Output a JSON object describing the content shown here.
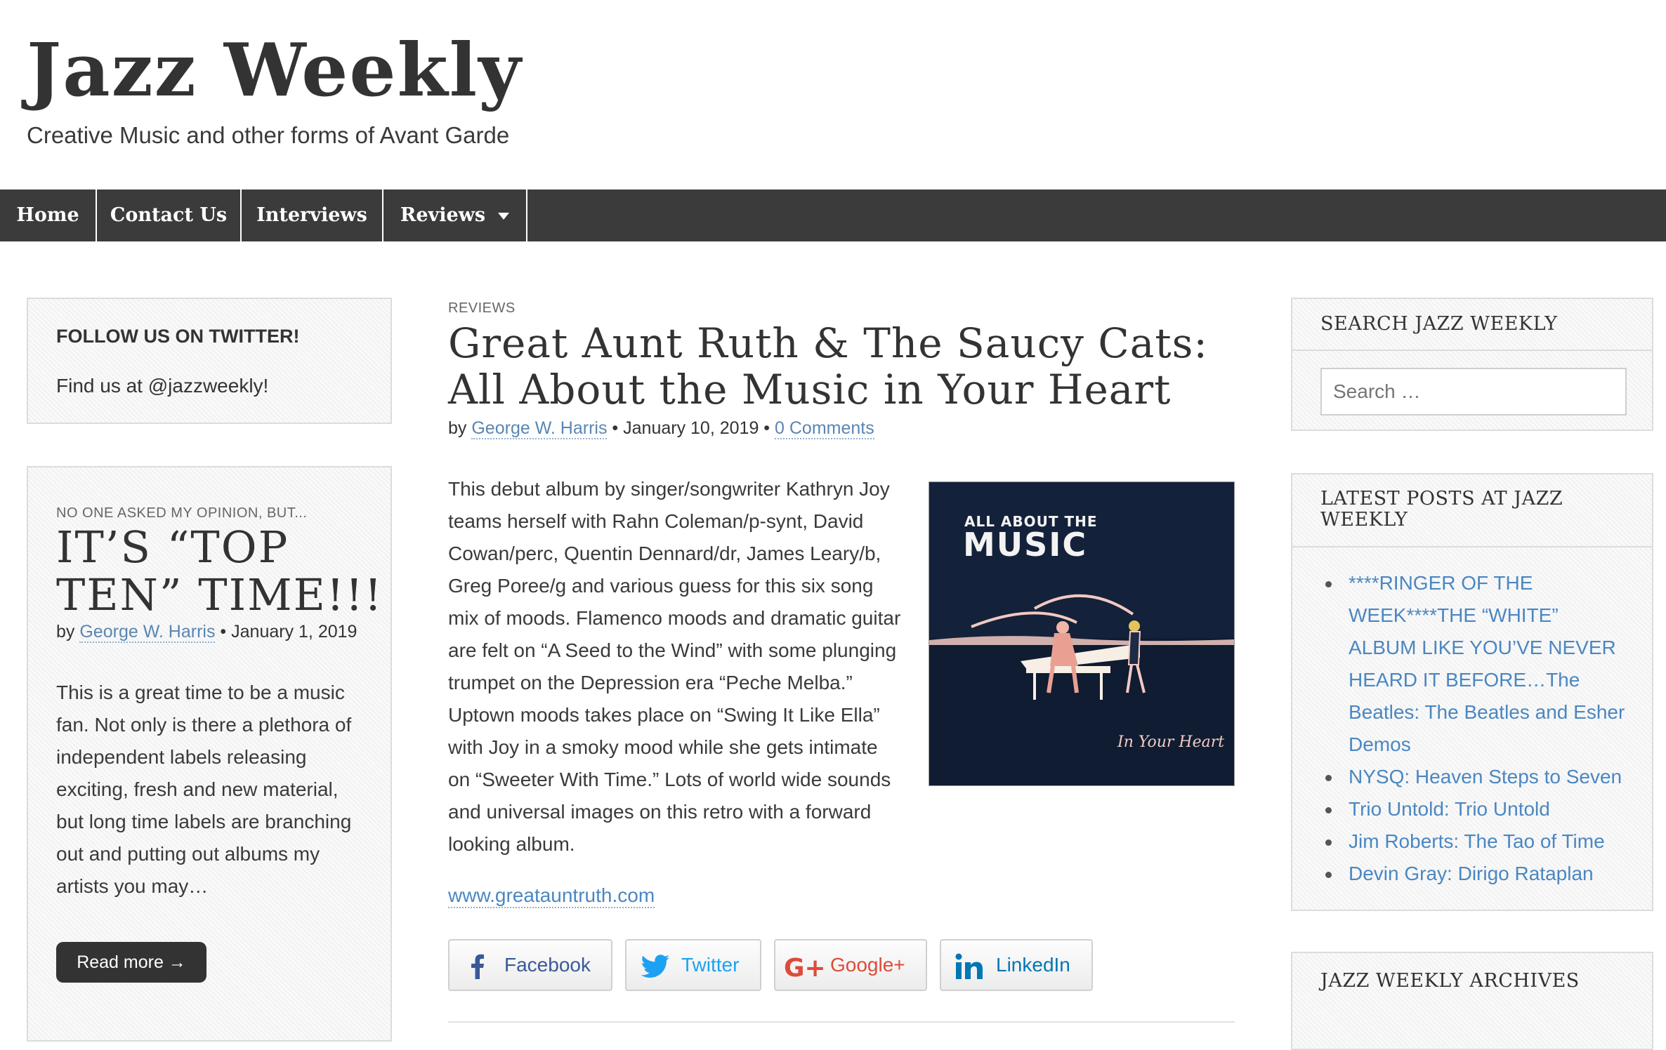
{
  "site": {
    "title": "Jazz Weekly",
    "tagline": "Creative Music and other forms of Avant Garde"
  },
  "nav": {
    "home": "Home",
    "contact": "Contact Us",
    "interviews": "Interviews",
    "reviews": "Reviews"
  },
  "left": {
    "twitter_widget": {
      "title": "FOLLOW US ON TWITTER!",
      "text": "Find us at @jazzweekly!"
    },
    "featured": {
      "category": "NO ONE ASKED MY OPINION, BUT...",
      "title_line1": "IT’S “TOP",
      "title_line2": "TEN” TIME!!!",
      "by": "by",
      "author": "George W. Harris",
      "separator": "•",
      "date": "January 1, 2019",
      "excerpt": "This is a great time to be a music fan. Not only is there a plethora of independent labels releasing exciting, fresh and new material, but long time labels are branching out and putting out albums my artists you may…",
      "read_more": "Read more →"
    }
  },
  "post": {
    "category": "REVIEWS",
    "title_line1": "Great Aunt Ruth & The Saucy Cats:",
    "title_line2": "All About the Music in Your Heart",
    "by": "by",
    "author": "George W. Harris",
    "sep1": "•",
    "date": "January 10, 2019",
    "sep2": "•",
    "comments": "0 Comments",
    "body": "This debut album by singer/songwriter Kathryn Joy teams herself with Rahn Coleman/p-synt, David Cowan/perc, Quentin Dennard/dr, James Leary/b, Greg Poree/g and various guess for this six song mix of moods. Flamenco moods and dramatic guitar are felt on “A Seed to the Wind” with some plunging trumpet on the Depression era “Peche Melba.” Uptown moods takes place on “Swing It Like Ella” with Joy in a smoky mood while she gets intimate on “Sweeter With Time.” Lots of world wide sounds and universal images on this retro with a forward looking album.",
    "link": "www.greatauntruth.com",
    "album": {
      "line1": "ALL ABOUT THE",
      "line2": "MUSIC",
      "script": "In Your Heart",
      "colors": {
        "bg": "#13223a",
        "accent": "#f2c9c2"
      }
    },
    "share": {
      "facebook": "Facebook",
      "twitter": "Twitter",
      "google": "Google+",
      "linkedin": "LinkedIn"
    }
  },
  "right": {
    "search": {
      "title": "SEARCH JAZZ WEEKLY",
      "placeholder": "Search …"
    },
    "latest": {
      "title_line1": "LATEST POSTS AT JAZZ",
      "title_line2": "WEEKLY",
      "items": [
        "****RINGER OF THE WEEK****THE “WHITE” ALBUM LIKE YOU’VE NEVER HEARD IT BEFORE…The Beatles: The Beatles and Esher Demos",
        "NYSQ: Heaven Steps to Seven",
        "Trio Untold: Trio Untold",
        "Jim Roberts: The Tao of Time",
        "Devin Gray: Dirigo Rataplan"
      ]
    },
    "archives": {
      "title": "JAZZ WEEKLY ARCHIVES"
    }
  },
  "colors": {
    "nav_bg": "#3b3b3b",
    "link": "#4a87c2",
    "facebook": "#3b5998",
    "twitter": "#1da1f2",
    "google": "#dd4b39",
    "linkedin": "#0077b5"
  }
}
